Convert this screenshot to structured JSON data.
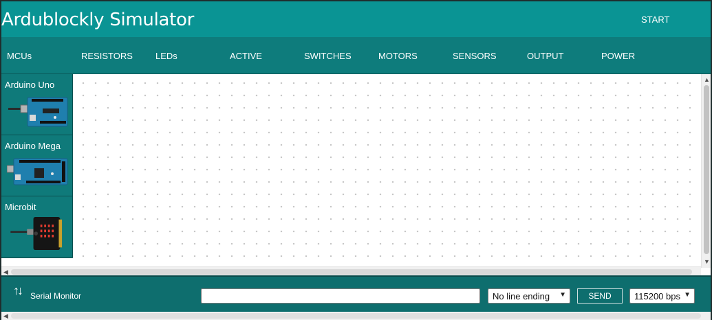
{
  "header": {
    "title": "Ardublockly Simulator",
    "start_label": "START"
  },
  "nav": {
    "items": [
      "MCUs",
      "RESISTORS",
      "LEDs",
      "ACTIVE",
      "SWITCHES",
      "MOTORS",
      "SENSORS",
      "OUTPUT",
      "POWER"
    ]
  },
  "palette": {
    "items": [
      {
        "label": "Arduino Uno",
        "icon": "arduino-uno-board-icon"
      },
      {
        "label": "Arduino Mega",
        "icon": "arduino-mega-board-icon"
      },
      {
        "label": "Microbit",
        "icon": "microbit-board-icon"
      }
    ]
  },
  "serial": {
    "label": "Serial Monitor",
    "icon": "up-down-arrows-icon",
    "input_value": "",
    "line_ending": "No line ending",
    "send_label": "SEND",
    "baud_rate": "115200 bps"
  },
  "colors": {
    "header": "#0a9494",
    "navbar": "#0e7c7c",
    "panel": "#0e7272",
    "canvas": "#ffffff"
  }
}
